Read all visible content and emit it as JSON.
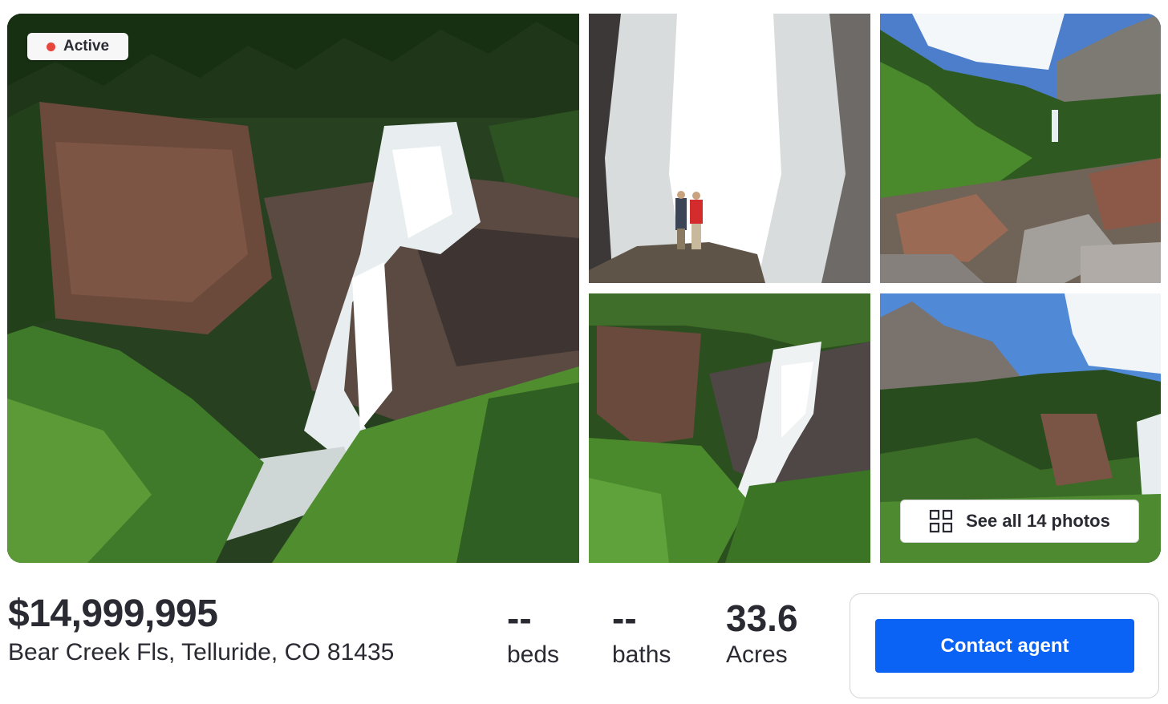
{
  "listing": {
    "status": "Active",
    "price": "$14,999,995",
    "address": "Bear Creek Fls, Telluride, CO 81435",
    "beds": {
      "value": "--",
      "label": "beds"
    },
    "baths": {
      "value": "--",
      "label": "baths"
    },
    "acres": {
      "value": "33.6",
      "label": "Acres"
    }
  },
  "gallery": {
    "see_all_label": "See all 14 photos",
    "photos": [
      "waterfall-cliff-main",
      "hikers-at-waterfall",
      "creek-valley-rocks",
      "waterfall-forest",
      "mountain-forest-sky"
    ]
  },
  "actions": {
    "contact_label": "Contact agent"
  },
  "colors": {
    "accent": "#0b63f6",
    "status_dot": "#e8453c",
    "text": "#2a2a33"
  },
  "icons": {
    "status": "status-dot-icon",
    "gallery": "grid-icon"
  }
}
